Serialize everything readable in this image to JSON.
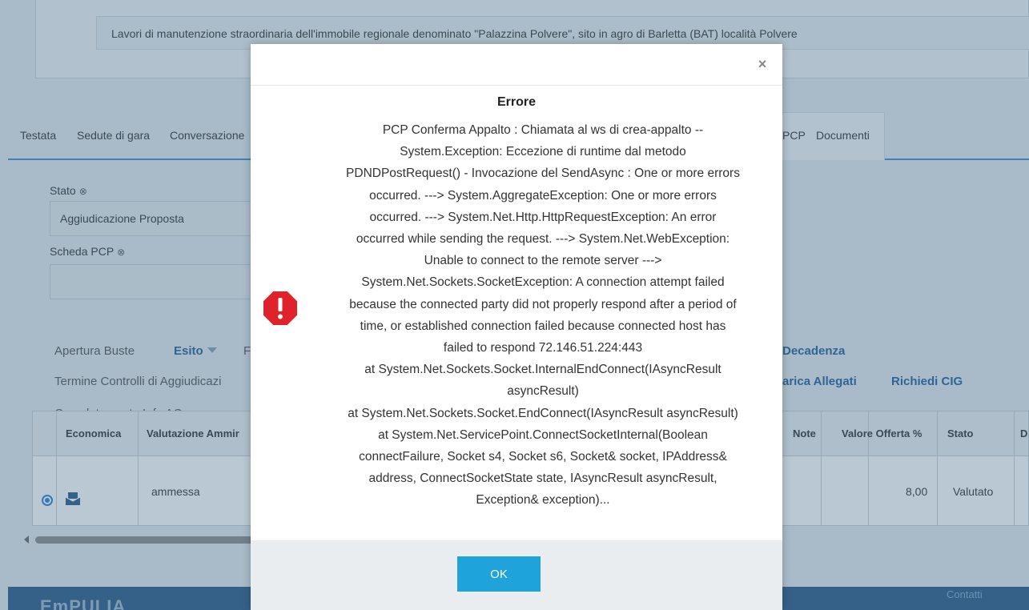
{
  "description": "Lavori di manutenzione straordinaria dell'immobile regionale denominato \"Palazzina Polvere\", sito in agro di Barletta (BAT) località Polvere",
  "tabs": [
    "Testata",
    "Sedute di gara",
    "Conversazione",
    "PCP",
    "Documenti"
  ],
  "fields": {
    "stato_label": "Stato",
    "stato_value": "Aggiudicazione Proposta",
    "scheda_label": "Scheda PCP",
    "scheda_value": "",
    "clear_glyph": "⊗"
  },
  "actions": {
    "apertura_buste": "Apertura Buste",
    "esito": "Esito",
    "truncated_p": "F",
    "decadenza": "Decadenza",
    "termine_controlli": "Termine Controlli di Aggiudicazi",
    "scarica_allegati": "arica Allegati",
    "richiedi_cig": "Richiedi CIG",
    "completamento": "Completamento Info AQ"
  },
  "grid": {
    "headers": [
      "Economica",
      "Valutazione Ammir",
      "Note",
      "Valore Offerta %",
      "Stato",
      "D"
    ],
    "row": {
      "valutazione": "ammessa",
      "valore": "8,00",
      "stato": "Valutato"
    }
  },
  "footer": {
    "logo": "EmPULIA",
    "contatti": "Contatti"
  },
  "modal": {
    "close_glyph": "×",
    "title": "Errore",
    "message_lines": [
      "PCP Conferma Appalto : Chiamata al ws di crea-appalto --",
      "System.Exception: Eccezione di runtime dal metodo",
      "PDNDPostRequest() - Invocazione del SendAsync : One or more errors",
      "occurred. ---> System.AggregateException: One or more errors",
      "occurred. ---> System.Net.Http.HttpRequestException: An error",
      "occurred while sending the request. ---> System.Net.WebException:",
      "Unable to connect to the remote server --->",
      "System.Net.Sockets.SocketException: A connection attempt failed",
      "because the connected party did not properly respond after a period of",
      "time, or established connection failed because connected host has",
      "failed to respond 72.146.51.224:443",
      "at System.Net.Sockets.Socket.InternalEndConnect(IAsyncResult",
      "asyncResult)",
      "at System.Net.Sockets.Socket.EndConnect(IAsyncResult asyncResult)",
      "at System.Net.ServicePoint.ConnectSocketInternal(Boolean",
      "connectFailure, Socket s4, Socket s6, Socket& socket, IPAddress&",
      "address, ConnectSocketState state, IAsyncResult asyncResult,",
      "Exception& exception)..."
    ],
    "ok_label": "OK"
  },
  "colors": {
    "accent": "#1ea4da",
    "error": "#e0222b",
    "link": "#1f5f9a"
  }
}
